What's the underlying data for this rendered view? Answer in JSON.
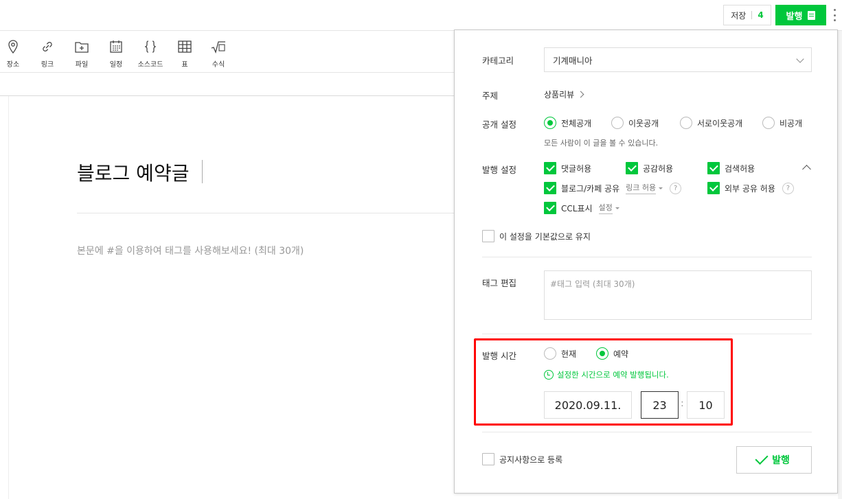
{
  "topbar": {
    "save_label": "저장",
    "save_count": "4",
    "publish_label": "발행"
  },
  "toolbar": {
    "items": [
      {
        "label": "장소",
        "icon": "location-pin-icon"
      },
      {
        "label": "링크",
        "icon": "link-icon"
      },
      {
        "label": "파일",
        "icon": "file-add-icon"
      },
      {
        "label": "일정",
        "icon": "calendar-icon"
      },
      {
        "label": "소스코드",
        "icon": "braces-icon"
      },
      {
        "label": "표",
        "icon": "table-icon"
      },
      {
        "label": "수식",
        "icon": "sqrt-icon"
      }
    ]
  },
  "editor": {
    "title": "블로그 예약글",
    "tag_hint": "본문에 #을 이용하여 태그를 사용해보세요! (최대 30개)"
  },
  "panel": {
    "category_label": "카테고리",
    "category_value": "기계매니아",
    "topic_label": "주제",
    "topic_value": "상품리뷰",
    "visibility_label": "공개 설정",
    "visibility_options": [
      "전체공개",
      "이웃공개",
      "서로이웃공개",
      "비공개"
    ],
    "visibility_selected": "전체공개",
    "visibility_desc": "모든 사람이 이 글을 볼 수 있습니다.",
    "publish_settings_label": "발행 설정",
    "checks": {
      "comments": "댓글허용",
      "likes": "공감허용",
      "search": "검색허용",
      "share_blog_cafe": "블로그/카페 공유",
      "share_blog_cafe_sub": "링크 허용",
      "external_share": "외부 공유 허용",
      "ccl": "CCL표시",
      "ccl_sub": "설정"
    },
    "help_mark": "?",
    "keep_default_label": "이 설정을 기본값으로 유지",
    "tag_label": "태그 편집",
    "tag_placeholder": "#태그 입력 (최대 30개)",
    "time_label": "발행 시간",
    "time_options": [
      "현재",
      "예약"
    ],
    "time_selected": "예약",
    "schedule_notice": "설정한 시간으로 예약 발행됩니다.",
    "date": "2020.09.11.",
    "hour": "23",
    "minute": "10",
    "colon": ":",
    "notice_register_label": "공지사항으로 등록",
    "final_publish_label": "발행"
  },
  "colors": {
    "accent": "#00c73c",
    "highlight": "#ff0000"
  }
}
